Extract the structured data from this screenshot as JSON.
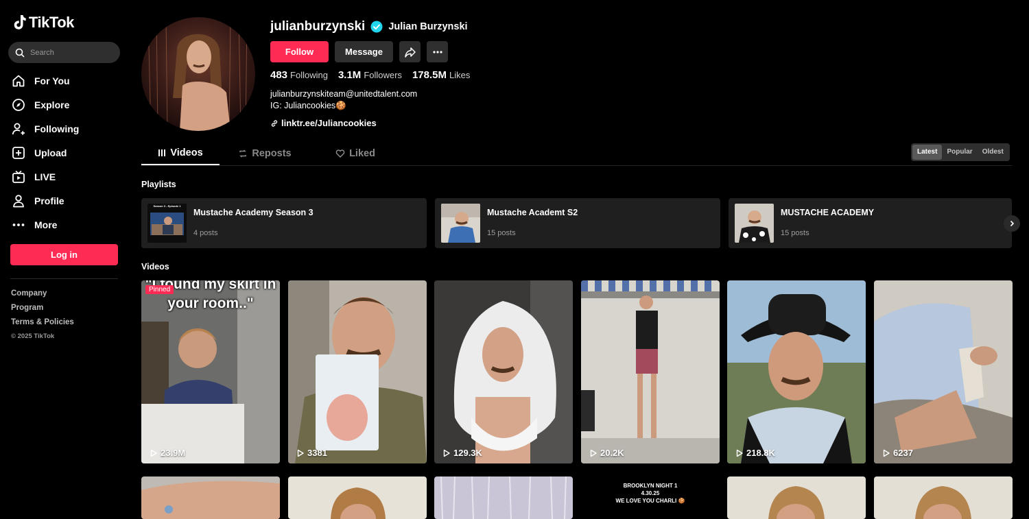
{
  "brand": {
    "name": "TikTok",
    "accent": "#fe2c55"
  },
  "search": {
    "placeholder": "Search"
  },
  "nav": [
    {
      "label": "For You",
      "icon": "home-icon"
    },
    {
      "label": "Explore",
      "icon": "compass-icon"
    },
    {
      "label": "Following",
      "icon": "user-plus-icon"
    },
    {
      "label": "Upload",
      "icon": "plus-square-icon"
    },
    {
      "label": "LIVE",
      "icon": "live-tv-icon"
    },
    {
      "label": "Profile",
      "icon": "person-icon"
    },
    {
      "label": "More",
      "icon": "more-dots-icon"
    }
  ],
  "login_label": "Log in",
  "footer": {
    "company": "Company",
    "program": "Program",
    "terms": "Terms & Policies",
    "copyright": "© 2025 TikTok"
  },
  "profile": {
    "username": "julianburzynski",
    "display_name": "Julian Burzynski",
    "verified": true,
    "follow_label": "Follow",
    "message_label": "Message",
    "stats": {
      "following_value": "483",
      "following_label": "Following",
      "followers_value": "3.1M",
      "followers_label": "Followers",
      "likes_value": "178.5M",
      "likes_label": "Likes"
    },
    "bio_line1": "julianburzynskiteam@unitedtalent.com",
    "bio_line2": "IG: Juliancookies🍪",
    "link": "linktr.ee/Juliancookies"
  },
  "tabs": {
    "videos": "Videos",
    "reposts": "Reposts",
    "liked": "Liked"
  },
  "sort": {
    "latest": "Latest",
    "popular": "Popular",
    "oldest": "Oldest"
  },
  "playlists_title": "Playlists",
  "playlists": [
    {
      "name": "Mustache Academy Season 3",
      "posts": "4 posts",
      "thumb_text": "Season 3 - Episode 1"
    },
    {
      "name": "Mustache Academt S2",
      "posts": "15 posts"
    },
    {
      "name": "MUSTACHE ACADEMY",
      "posts": "15 posts"
    }
  ],
  "videos_title": "Videos",
  "videos": [
    {
      "views": "23.9M",
      "pinned_label": "Pinned",
      "caption": "\"I found my skirt in your room..\""
    },
    {
      "views": "3381"
    },
    {
      "views": "129.3K"
    },
    {
      "views": "20.2K"
    },
    {
      "views": "218.8K"
    },
    {
      "views": "6237"
    }
  ],
  "videos_row2": [
    {
      "overlay": "BROOKLYN NIGHT 1\n4.30.25\nWE LOVE YOU CHARLI 🍪"
    }
  ]
}
